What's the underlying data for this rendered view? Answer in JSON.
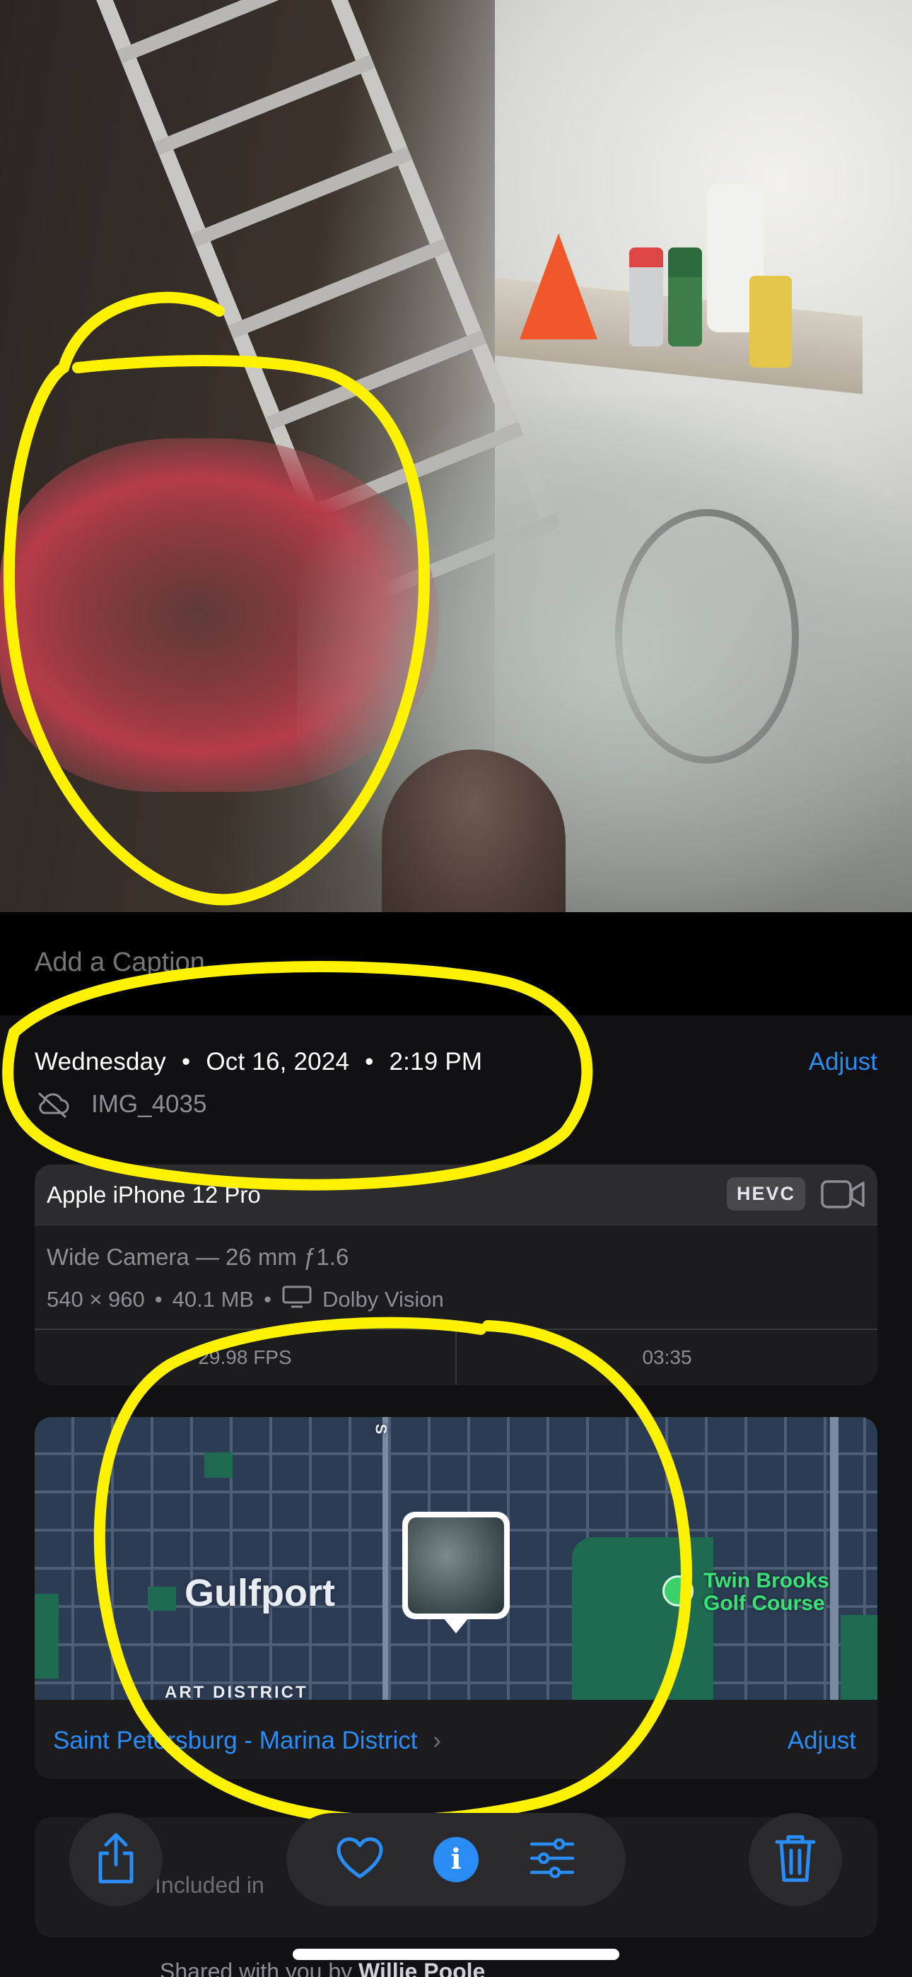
{
  "photo": {
    "description_icon": "photo-icon"
  },
  "caption": {
    "placeholder": "Add a Caption"
  },
  "datetime": {
    "day": "Wednesday",
    "date": "Oct 16, 2024",
    "time": "2:19 PM",
    "separator": "•",
    "adjust_label": "Adjust"
  },
  "file": {
    "name": "IMG_4035",
    "icon": "cloud-off-icon"
  },
  "camera": {
    "device": "Apple iPhone 12 Pro",
    "format_badge": "HEVC",
    "media_icon": "video-camera-icon",
    "lens": "Wide Camera — 26 mm ƒ1.6",
    "resolution": "540 × 960",
    "size": "40.1 MB",
    "hdr": "Dolby Vision",
    "fps": "29.98 FPS",
    "duration": "03:35"
  },
  "map": {
    "city_label": "Gulfport",
    "district_label": "ART DISTRICT",
    "street_label": "S",
    "poi_label_line1": "Twin Brooks",
    "poi_label_line2": "Golf Course",
    "location_name": "Saint Petersburg - Marina District",
    "adjust_label": "Adjust"
  },
  "peek": {
    "text": "Included in"
  },
  "shared": {
    "prefix": "Shared with you by",
    "name": "Willie Poole"
  },
  "toolbar": {
    "share_icon": "share-icon",
    "favorite_icon": "heart-icon",
    "info_label": "i",
    "edit_icon": "sliders-icon",
    "delete_icon": "trash-icon"
  },
  "colors": {
    "accent": "#2a8cf5",
    "annotation": "#fff200",
    "background": "#111113",
    "card": "#1c1c1e"
  }
}
